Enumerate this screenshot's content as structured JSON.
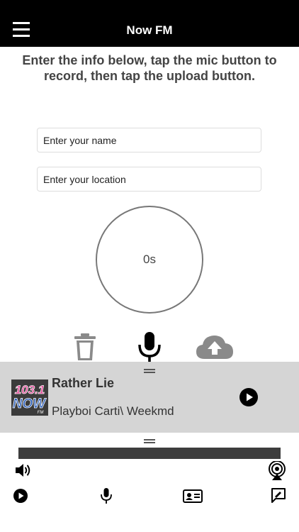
{
  "header": {
    "title": "Now FM",
    "menu_icon": "hamburger-menu-icon"
  },
  "instructions": "Enter the info below, tap the mic button to record, then tap the upload button.",
  "form": {
    "name_placeholder": "Enter your name",
    "location_placeholder": "Enter your location"
  },
  "recorder": {
    "elapsed": "0s",
    "buttons": [
      "trash-icon",
      "microphone-icon",
      "cloud-upload-icon"
    ]
  },
  "now_playing": {
    "title": "Rather Lie",
    "artist": "Playboi Carti\\ Weekmd",
    "station_logo": {
      "number": "103.1",
      "name": "NOW",
      "suffix": "FM"
    }
  },
  "bottom_nav": {
    "icons": [
      "volume-icon",
      "airplay-icon",
      "play-icon",
      "microphone-icon",
      "contact-card-icon",
      "chat-icon"
    ]
  },
  "colors": {
    "header_bg": "#000000",
    "player_bg": "#d5d5d5",
    "progress_bar": "#3d3d3d",
    "logo_pink": "#e0318a",
    "logo_blue": "#2a5db8"
  }
}
